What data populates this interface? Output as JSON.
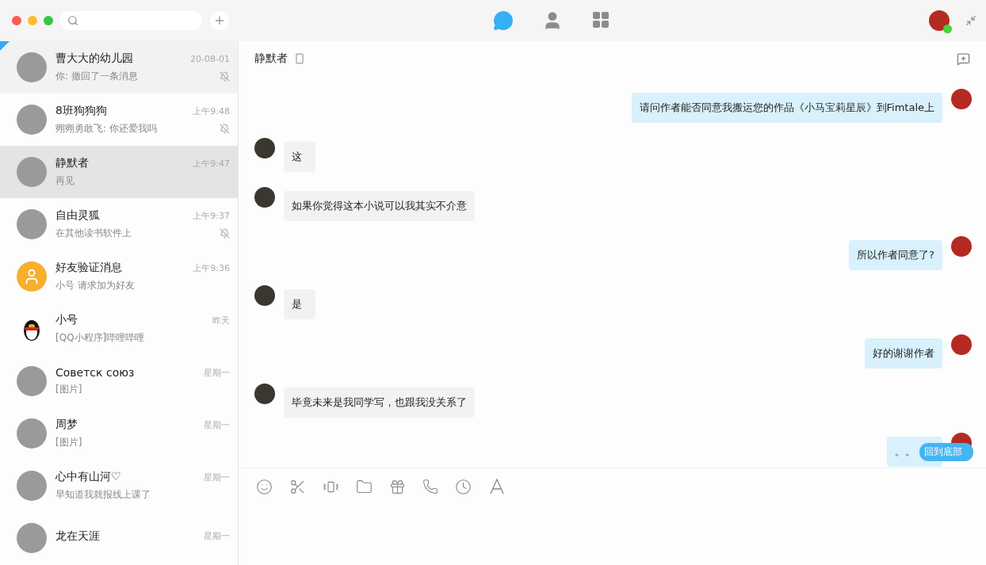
{
  "nav_tabs": [
    {
      "kind": "chat",
      "selected": true
    },
    {
      "kind": "contacts",
      "selected": false
    },
    {
      "kind": "apps",
      "selected": false
    }
  ],
  "conversations": [
    {
      "kind": "photo",
      "name": "曹大大的幼儿园",
      "preview": "你: 撤回了一条消息",
      "time": "20-08-01",
      "muted": true,
      "pinned": true,
      "selected": false
    },
    {
      "kind": "photo",
      "name": "8班狗狗狗",
      "preview": "翙翙勇敢飞: 你还爱我吗",
      "time": "上午9:48",
      "muted": true,
      "pinned": false,
      "selected": false
    },
    {
      "kind": "photo",
      "name": "静默者",
      "preview": "再见",
      "time": "上午9:47",
      "muted": false,
      "pinned": false,
      "selected": true
    },
    {
      "kind": "photo",
      "name": "自由灵狐",
      "preview": "在其他读书软件上",
      "time": "上午9:37",
      "muted": true,
      "pinned": false,
      "selected": false
    },
    {
      "kind": "system",
      "name": "好友验证消息",
      "preview": "小号 请求加为好友",
      "time": "上午9:36",
      "muted": false,
      "pinned": false,
      "selected": false
    },
    {
      "kind": "penguin",
      "name": "小号",
      "preview": "[QQ小程序]哔哩哔哩",
      "time": "昨天",
      "muted": false,
      "pinned": false,
      "selected": false
    },
    {
      "kind": "photo",
      "name": "Советск союз",
      "preview": "[图片]",
      "time": "星期一",
      "muted": false,
      "pinned": false,
      "selected": false
    },
    {
      "kind": "photo",
      "name": "周梦",
      "preview": "[图片]",
      "time": "星期一",
      "muted": false,
      "pinned": false,
      "selected": false
    },
    {
      "kind": "photo",
      "name": "心中有山河♡",
      "preview": "早知道我就报线上课了",
      "time": "星期一",
      "muted": false,
      "pinned": false,
      "selected": false
    },
    {
      "kind": "photo",
      "name": "龙在天涯",
      "time": "星期一",
      "muted": false,
      "pinned": false,
      "selected": false
    }
  ],
  "chat": {
    "title": "静默者",
    "messages": [
      {
        "kind": "sent",
        "text": "请问作者能否同意我搬运您的作品《小马宝莉星辰》到Fimtale上"
      },
      {
        "kind": "received",
        "text": "这"
      },
      {
        "kind": "received",
        "text": "如果你觉得这本小说可以我其实不介意"
      },
      {
        "kind": "sent",
        "text": "所以作者同意了?"
      },
      {
        "kind": "received",
        "text": "是"
      },
      {
        "kind": "sent",
        "text": "好的谢谢作者"
      },
      {
        "kind": "received",
        "text": "毕竟未来是我同学写，也跟我没关系了"
      },
      {
        "kind": "sent",
        "text": "。。"
      }
    ],
    "jump_button": "回到底部"
  }
}
